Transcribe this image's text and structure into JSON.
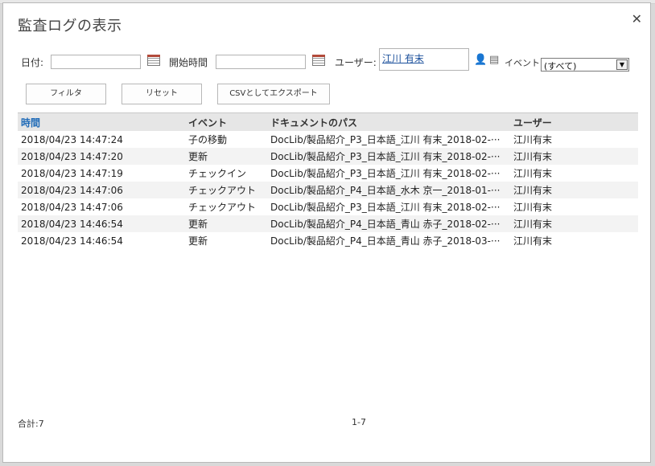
{
  "dialog": {
    "title": "監査ログの表示",
    "close_label": "✕"
  },
  "filters": {
    "date_label": "日付:",
    "date_value": "",
    "start_time_label": "開始時間",
    "start_time_value": "",
    "user_label": "ユーザー:",
    "user_value": "江川 有末",
    "event_label": "イベント",
    "event_value": "(すべて)"
  },
  "buttons": {
    "filter": "フィルタ",
    "reset": "リセット",
    "export": "CSVとしてエクスポート"
  },
  "table": {
    "columns": [
      "時間",
      "イベント",
      "ドキュメントのパス",
      "ユーザー"
    ],
    "rows": [
      [
        "2018/04/23 14:47:24",
        "子の移動",
        "DocLib/製品紹介_P3_日本語_江川 有末_2018-02-···",
        "江川有末"
      ],
      [
        "2018/04/23 14:47:20",
        "更新",
        "DocLib/製品紹介_P3_日本語_江川 有末_2018-02-···",
        "江川有末"
      ],
      [
        "2018/04/23 14:47:19",
        "チェックイン",
        "DocLib/製品紹介_P3_日本語_江川 有末_2018-02-···",
        "江川有末"
      ],
      [
        "2018/04/23 14:47:06",
        "チェックアウト",
        "DocLib/製品紹介_P4_日本語_水木 京一_2018-01-···",
        "江川有末"
      ],
      [
        "2018/04/23 14:47:06",
        "チェックアウト",
        "DocLib/製品紹介_P3_日本語_江川 有末_2018-02-···",
        "江川有末"
      ],
      [
        "2018/04/23 14:46:54",
        "更新",
        "DocLib/製品紹介_P4_日本語_青山 赤子_2018-02-···",
        "江川有末"
      ],
      [
        "2018/04/23 14:46:54",
        "更新",
        "DocLib/製品紹介_P4_日本語_青山 赤子_2018-03-···",
        "江川有末"
      ]
    ]
  },
  "footer": {
    "total": "合計:7",
    "range": "1-7"
  },
  "colors": {
    "accent_link": "#1e6ab7",
    "user_link": "#1a4f9b",
    "header_bg": "#e6e6e6",
    "alt_row_bg": "#f3f3f3"
  },
  "icons": [
    "close-icon",
    "calendar-icon",
    "people-picker-icon",
    "address-book-icon",
    "dropdown-arrow-icon"
  ]
}
